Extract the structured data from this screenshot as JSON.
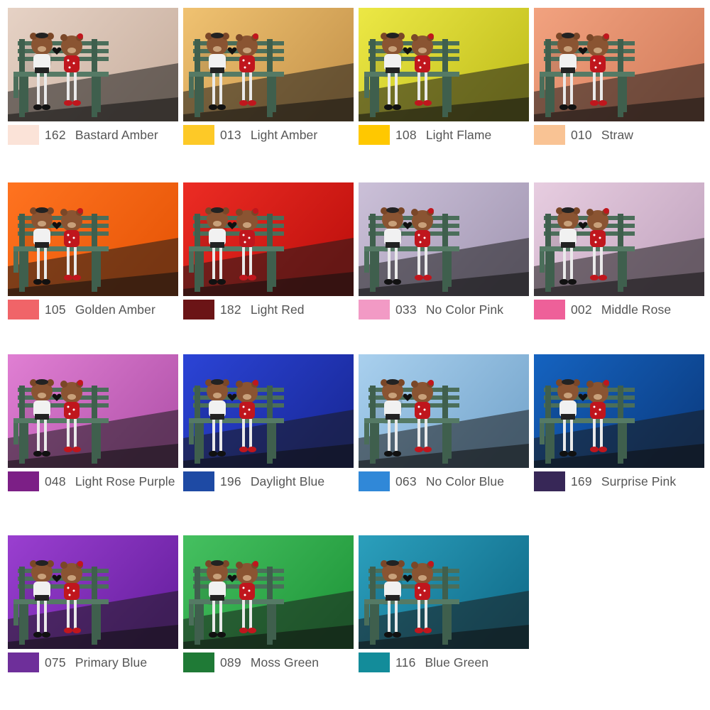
{
  "filters": [
    {
      "code": "162",
      "name": "Bastard Amber",
      "swatch": "#fbe3d8",
      "photo_top": "#e6d2c5",
      "photo_bottom": "#cbb3a3"
    },
    {
      "code": "013",
      "name": "Light Amber",
      "swatch": "#fdc927",
      "photo_top": "#f0c271",
      "photo_bottom": "#c8974e"
    },
    {
      "code": "108",
      "name": "Light Flame",
      "swatch": "#ffc800",
      "photo_top": "#ece845",
      "photo_bottom": "#c4c120"
    },
    {
      "code": "010",
      "name": "Straw",
      "swatch": "#f9c394",
      "photo_top": "#f2a27f",
      "photo_bottom": "#d5805f"
    },
    {
      "code": "105",
      "name": "Golden Amber",
      "swatch": "#f06468",
      "photo_top": "#ff7320",
      "photo_bottom": "#e85708"
    },
    {
      "code": "182",
      "name": "Light Red",
      "swatch": "#6b1416",
      "photo_top": "#ec2c24",
      "photo_bottom": "#c1120e"
    },
    {
      "code": "033",
      "name": "No Color Pink",
      "swatch": "#f29ac5",
      "photo_top": "#cbc0d8",
      "photo_bottom": "#a79cb7"
    },
    {
      "code": "002",
      "name": "Middle Rose",
      "swatch": "#ee6099",
      "photo_top": "#e7cde0",
      "photo_bottom": "#c5a8c2"
    },
    {
      "code": "048",
      "name": "Light Rose Purple",
      "swatch": "#7c1f86",
      "photo_top": "#e07fd3",
      "photo_bottom": "#b556ad"
    },
    {
      "code": "196",
      "name": "Daylight Blue",
      "swatch": "#1e4aa4",
      "photo_top": "#2b44d6",
      "photo_bottom": "#1a2a9c"
    },
    {
      "code": "063",
      "name": "No Color Blue",
      "swatch": "#3088d8",
      "photo_top": "#a9d0ee",
      "photo_bottom": "#7aa9cf"
    },
    {
      "code": "169",
      "name": "Surprise Pink",
      "swatch": "#372757",
      "photo_top": "#1563c0",
      "photo_bottom": "#0c3f86"
    },
    {
      "code": "075",
      "name": "Primary Blue",
      "swatch": "#6e2f9a",
      "photo_top": "#9a3fd0",
      "photo_bottom": "#6b22a3"
    },
    {
      "code": "089",
      "name": "Moss Green",
      "swatch": "#1f7a36",
      "photo_top": "#45c060",
      "photo_bottom": "#239a3d"
    },
    {
      "code": "116",
      "name": "Blue Green",
      "swatch": "#138c9a",
      "photo_top": "#2b9fbc",
      "photo_bottom": "#13708e"
    }
  ]
}
